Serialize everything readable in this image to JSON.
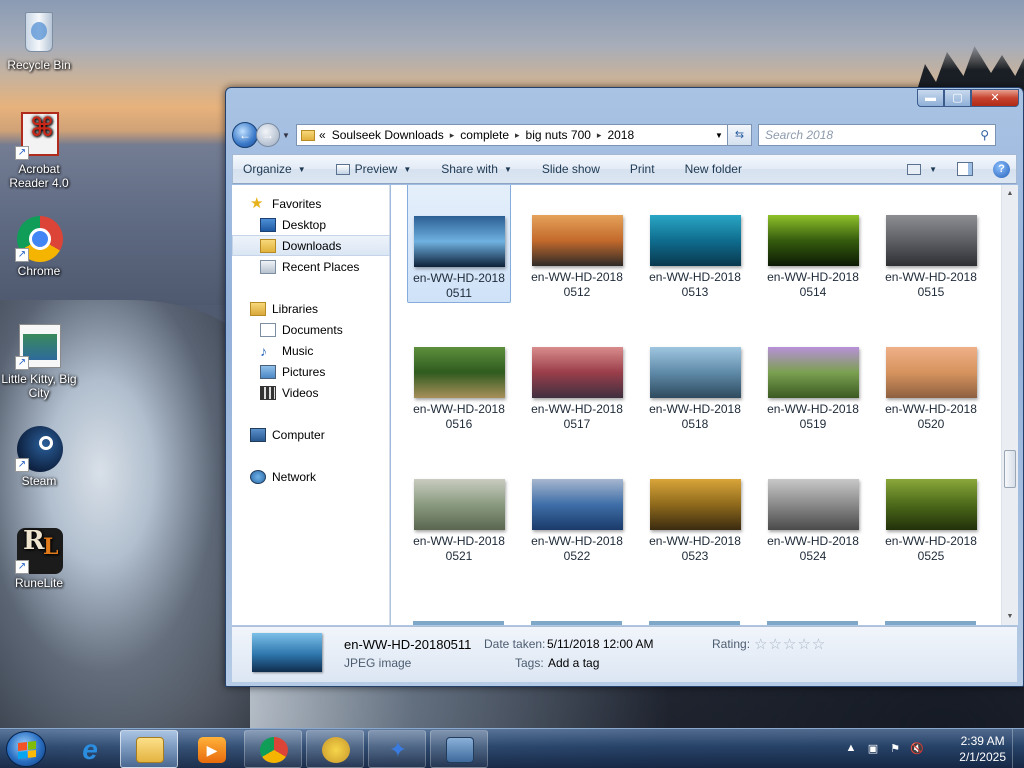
{
  "desktop": {
    "icons": [
      {
        "label": "Recycle Bin",
        "icon": "recycle-bin-icon"
      },
      {
        "label": "Acrobat Reader 4.0",
        "icon": "acrobat-icon"
      },
      {
        "label": "Chrome",
        "icon": "chrome-icon"
      },
      {
        "label": "Little Kitty, Big City",
        "icon": "game-icon"
      },
      {
        "label": "Steam",
        "icon": "steam-icon"
      },
      {
        "label": "RuneLite",
        "icon": "runelite-icon"
      }
    ]
  },
  "explorer": {
    "window_controls": {
      "minimize": "▬",
      "maximize": "▢",
      "close": "✕"
    },
    "address": {
      "prefix": "«",
      "crumbs": [
        "Soulseek Downloads",
        "complete",
        "big nuts 700",
        "2018"
      ]
    },
    "search_placeholder": "Search 2018",
    "toolbar": {
      "organize": "Organize",
      "preview": "Preview",
      "share_with": "Share with",
      "slide_show": "Slide show",
      "print": "Print",
      "new_folder": "New folder"
    },
    "nav": {
      "favorites": "Favorites",
      "desktop": "Desktop",
      "downloads": "Downloads",
      "recent_places": "Recent Places",
      "libraries": "Libraries",
      "documents": "Documents",
      "music": "Music",
      "pictures": "Pictures",
      "videos": "Videos",
      "computer": "Computer",
      "network": "Network"
    },
    "files": [
      {
        "line1": "en-WW-HD-2018",
        "line2": "0511",
        "colors": [
          "#2b5f94",
          "#6fb1e0",
          "#0d2038"
        ]
      },
      {
        "line1": "en-WW-HD-2018",
        "line2": "0512",
        "colors": [
          "#e4a25a",
          "#c46a2c",
          "#2e2a28"
        ]
      },
      {
        "line1": "en-WW-HD-2018",
        "line2": "0513",
        "colors": [
          "#2aa6c4",
          "#0f6d8f",
          "#09384d"
        ]
      },
      {
        "line1": "en-WW-HD-2018",
        "line2": "0514",
        "colors": [
          "#8fc12a",
          "#355c0e",
          "#0c1a04"
        ]
      },
      {
        "line1": "en-WW-HD-2018",
        "line2": "0515",
        "colors": [
          "#8d8e92",
          "#5e6066",
          "#2d2f33"
        ]
      },
      {
        "line1": "en-WW-HD-2018",
        "line2": "0516",
        "colors": [
          "#5d8f3d",
          "#2f5b1f",
          "#a88f5a"
        ]
      },
      {
        "line1": "en-WW-HD-2018",
        "line2": "0517",
        "colors": [
          "#d98c8c",
          "#9a3e4a",
          "#3f3040"
        ]
      },
      {
        "line1": "en-WW-HD-2018",
        "line2": "0518",
        "colors": [
          "#9fc6e0",
          "#5f8aa8",
          "#2e4a5e"
        ]
      },
      {
        "line1": "en-WW-HD-2018",
        "line2": "0519",
        "colors": [
          "#b890d8",
          "#7aa050",
          "#3b5a22"
        ]
      },
      {
        "line1": "en-WW-HD-2018",
        "line2": "0520",
        "colors": [
          "#f0b088",
          "#d6935e",
          "#8e6040"
        ]
      },
      {
        "line1": "en-WW-HD-2018",
        "line2": "0521",
        "colors": [
          "#c9ccc0",
          "#8a9a80",
          "#5a6650"
        ]
      },
      {
        "line1": "en-WW-HD-2018",
        "line2": "0522",
        "colors": [
          "#a7b7cf",
          "#3f6ea8",
          "#1a3a6a"
        ]
      },
      {
        "line1": "en-WW-HD-2018",
        "line2": "0523",
        "colors": [
          "#d9a53a",
          "#8f6a1c",
          "#3a2a10"
        ]
      },
      {
        "line1": "en-WW-HD-2018",
        "line2": "0524",
        "colors": [
          "#c8c8c8",
          "#8a8a8a",
          "#4a4a4a"
        ]
      },
      {
        "line1": "en-WW-HD-2018",
        "line2": "0525",
        "colors": [
          "#8aa83a",
          "#4c6a1a",
          "#22300a"
        ]
      }
    ],
    "details": {
      "name": "en-WW-HD-20180511",
      "type": "JPEG image",
      "date_label": "Date taken:",
      "date_value": "5/11/2018 12:00 AM",
      "tags_label": "Tags:",
      "tags_value": "Add a tag",
      "rating_label": "Rating:",
      "rating_stars": "☆☆☆☆☆",
      "rating_value": 0
    }
  },
  "taskbar": {
    "items": [
      "internet-explorer-icon",
      "file-explorer-icon",
      "media-player-icon",
      "chrome-icon",
      "bee-app-icon",
      "bird-app-icon",
      "network-app-icon"
    ],
    "clock_time": "2:39 AM",
    "clock_date": "2/1/2025"
  }
}
